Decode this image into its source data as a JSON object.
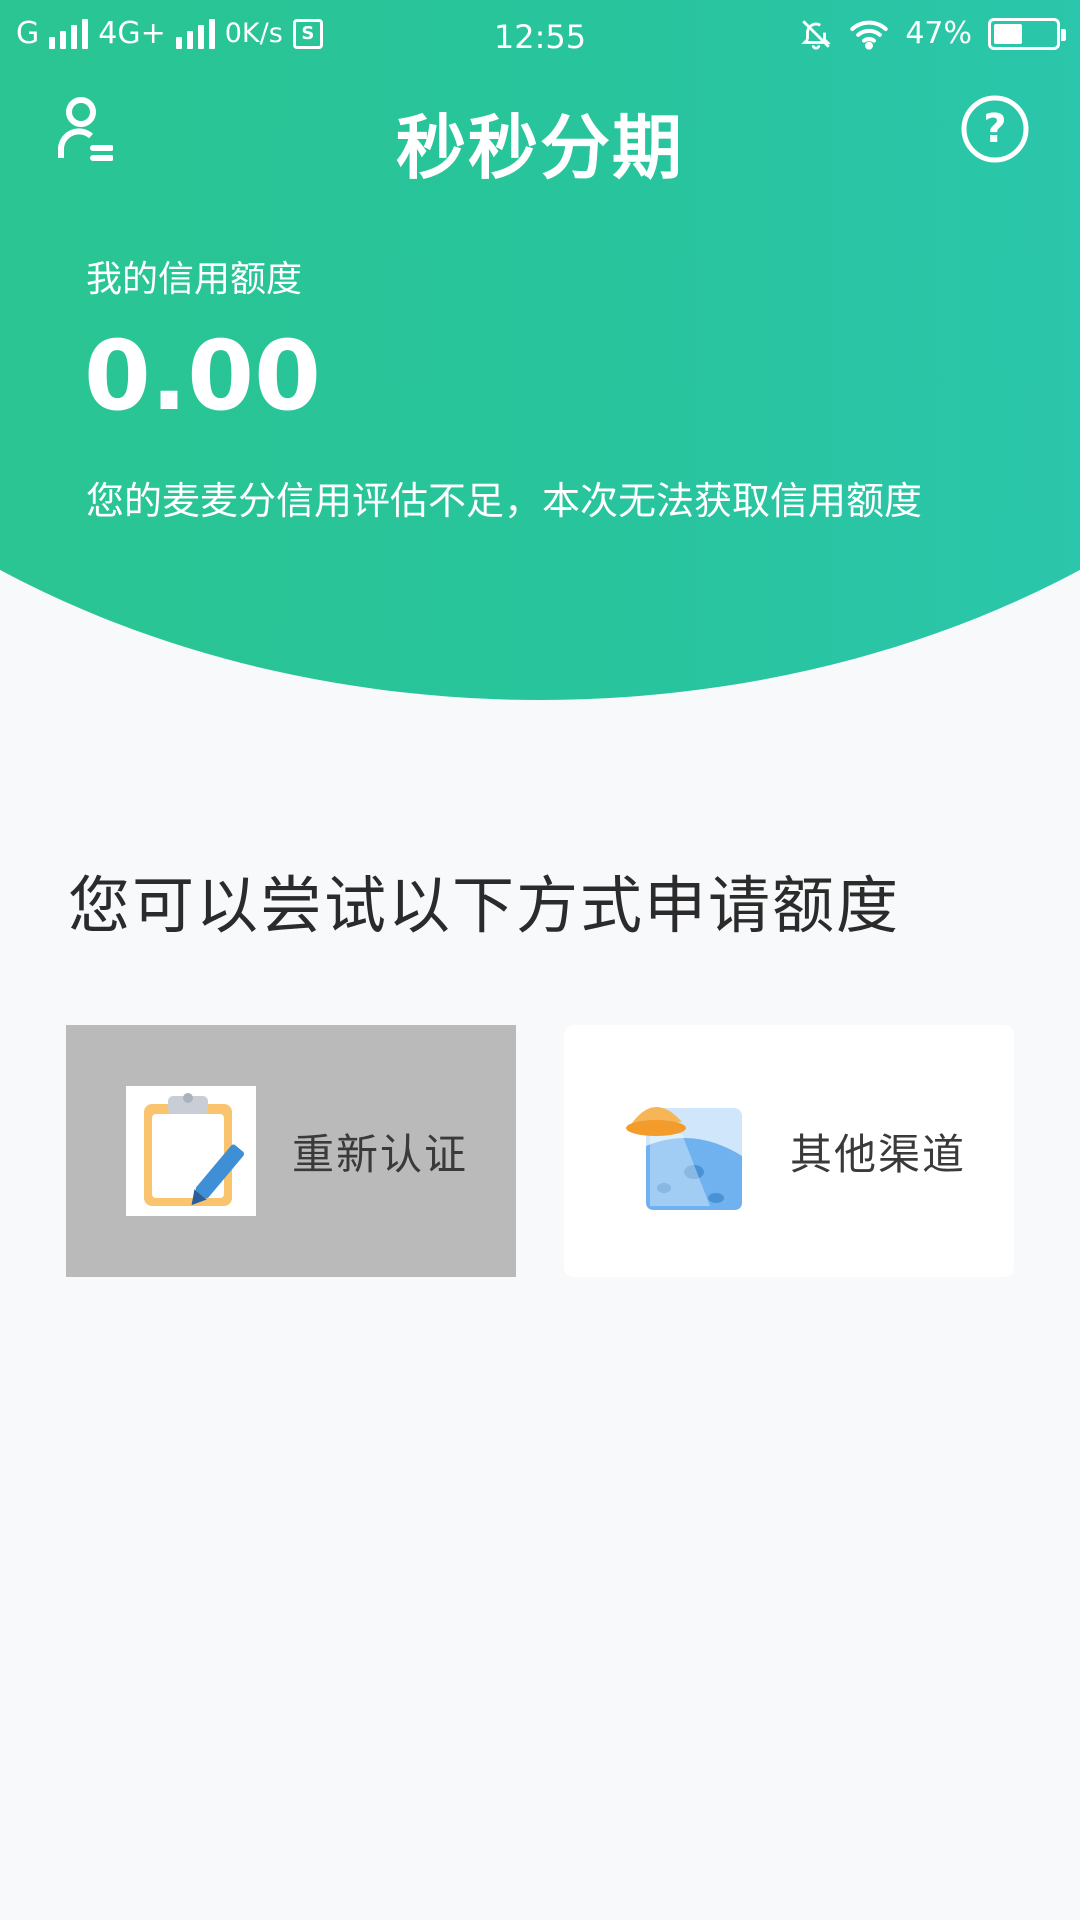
{
  "status_bar": {
    "network1": "G",
    "network2": "4G+",
    "speed": "0K/s",
    "sim_icon_text": "S",
    "time": "12:55",
    "battery_text": "47%",
    "battery_level": 0.47
  },
  "app_bar": {
    "title": "秒秒分期",
    "profile_icon": "user-profile-icon",
    "help_icon": "help-question-icon"
  },
  "credit": {
    "label": "我的信用额度",
    "amount": "0.00",
    "description": "您的麦麦分信用评估不足，本次无法获取信用额度"
  },
  "options_section": {
    "title": "您可以尝试以下方式申请额度",
    "options": [
      {
        "label": "重新认证",
        "icon": "clipboard-pen-icon"
      },
      {
        "label": "其他渠道",
        "icon": "ufo-planet-icon"
      }
    ]
  },
  "colors": {
    "primary_green": "#2ac592",
    "background": "#f7f9fb",
    "pressed_gray": "#bababa"
  }
}
